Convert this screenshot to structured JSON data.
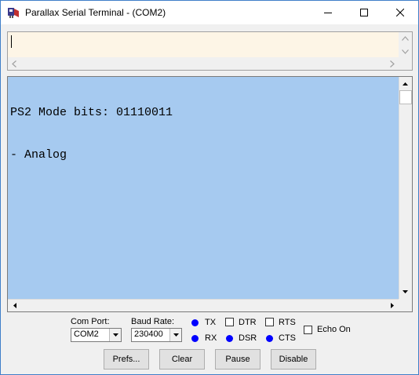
{
  "window": {
    "title": "Parallax Serial Terminal - (COM2)",
    "app_icon": "parallax-propeller-icon",
    "caption_buttons": [
      "minimize-icon",
      "maximize-icon",
      "close-icon"
    ]
  },
  "transmit": {
    "value": ""
  },
  "receive": {
    "lines": [
      "PS2 Mode bits: 01110011",
      "- Analog"
    ],
    "background_color": "#a6caf0"
  },
  "com_port": {
    "label": "Com Port:",
    "value": "COM2"
  },
  "baud_rate": {
    "label": "Baud Rate:",
    "value": "230400"
  },
  "indicators": {
    "tx": "TX",
    "rx": "RX",
    "dsr": "DSR",
    "cts": "CTS",
    "led_color": "#0000ff"
  },
  "toggles": {
    "dtr": "DTR",
    "rts": "RTS",
    "echo_on": "Echo On",
    "dtr_checked": false,
    "rts_checked": false,
    "echo_on_checked": false
  },
  "buttons": {
    "prefs": "Prefs...",
    "clear": "Clear",
    "pause": "Pause",
    "disable": "Disable"
  }
}
